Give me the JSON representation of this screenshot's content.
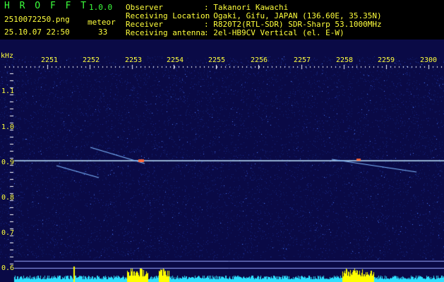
{
  "header": {
    "app_name": "H R O F F T",
    "version": "1.0.0",
    "filename": "2510072250.png",
    "datetime": "25.10.07 22:50",
    "meteor_label": "meteor",
    "meteor_count": "33",
    "info": [
      {
        "label": "Observer",
        "value": ": Takanori Kawachi"
      },
      {
        "label": "Receiving Location",
        "value": ": Ogaki, Gifu, JAPAN (136.60E, 35.35N)"
      },
      {
        "label": "Receiver",
        "value": ": R820T2(RTL-SDR) SDR-Sharp 53.1000MHz"
      },
      {
        "label": "Receiving antenna",
        "value": ": 2el-HB9CV Vertical (el. E-W)"
      }
    ]
  },
  "axes": {
    "y_unit": "kHz",
    "y_ticks": [
      "1.1",
      "1.0",
      "0.9",
      "0.8",
      "0.7",
      "0.6"
    ],
    "x_ticks": [
      "2251",
      "2252",
      "2253",
      "2254",
      "2255",
      "2256",
      "2257",
      "2258",
      "2259",
      "2300"
    ]
  },
  "colors": {
    "background": "#0a0a46",
    "label": "#ffff3c",
    "header_text": "#3cff3c",
    "tick_major": "#ffffff",
    "signal": "#bfe6ff",
    "spectrum": "#2ee0ff",
    "spectrum_peak": "#ffff00"
  }
}
